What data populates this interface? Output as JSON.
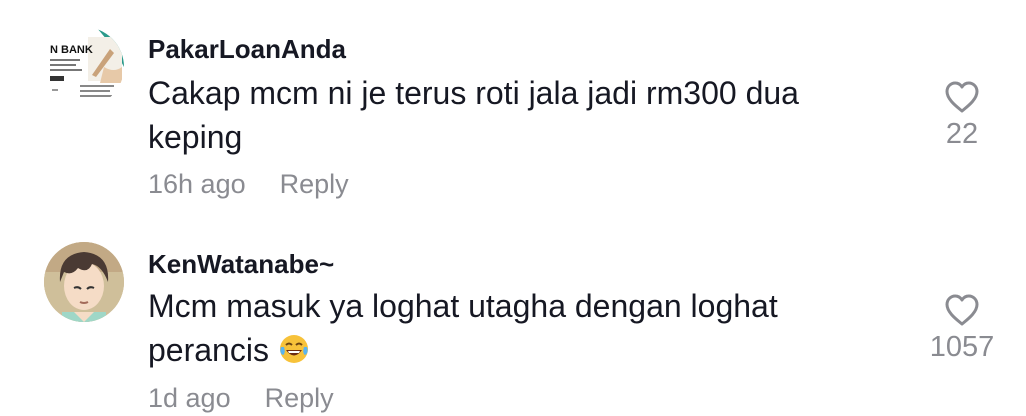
{
  "comments": [
    {
      "username": "PakarLoanAnda",
      "text": "Cakap mcm ni je terus roti jala jadi rm300 dua keping",
      "time": "16h ago",
      "reply_label": "Reply",
      "likes": "22",
      "avatar_text": "N BANK"
    },
    {
      "username": "KenWatanabe~",
      "text": "Mcm masuk ya loghat utagha dengan loghat perancis",
      "emoji": "laughing-tears-emoji",
      "time": "1d ago",
      "reply_label": "Reply",
      "likes": "1057"
    }
  ]
}
